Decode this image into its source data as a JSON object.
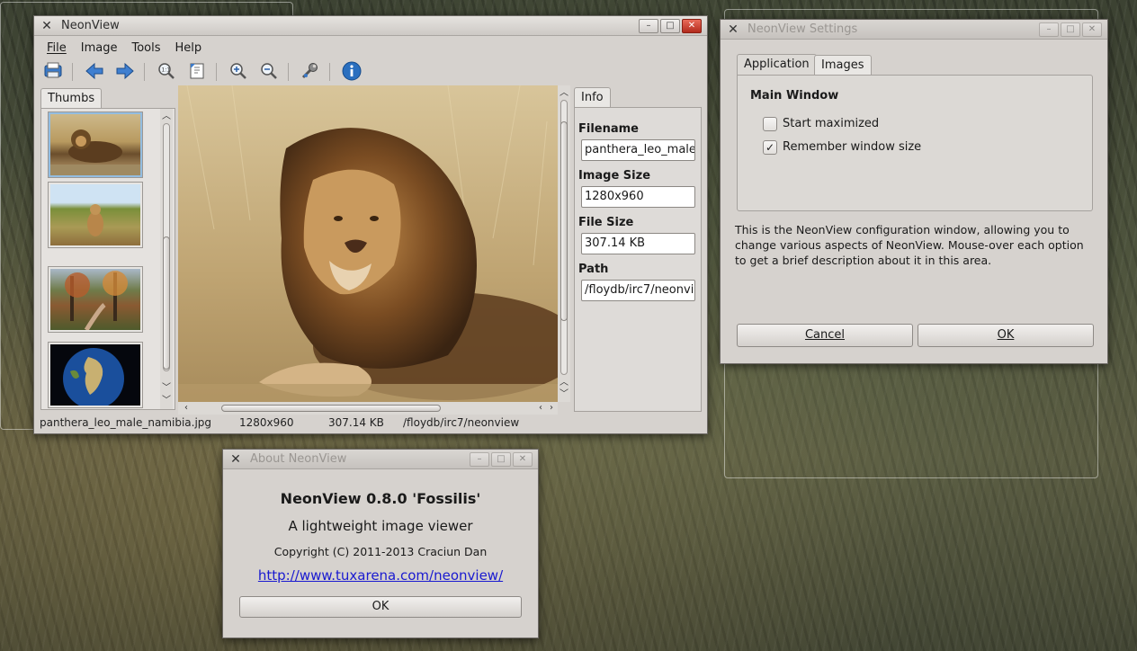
{
  "main_window": {
    "title": "NeonView",
    "menu": [
      "File",
      "Image",
      "Tools",
      "Help"
    ],
    "toolbar_icons": [
      "save-icon",
      "back-arrow-icon",
      "forward-arrow-icon",
      "zoom-original-icon",
      "fit-page-icon",
      "zoom-in-icon",
      "zoom-out-icon",
      "settings-wrench-icon",
      "info-icon"
    ],
    "thumbs_tab": "Thumbs",
    "info_tab": "Info",
    "info": {
      "filename_label": "Filename",
      "filename_value": "panthera_leo_male",
      "size_label": "Image Size",
      "size_value": "1280x960",
      "filesize_label": "File Size",
      "filesize_value": "307.14 KB",
      "path_label": "Path",
      "path_value": "/floydb/irc7/neonvie"
    },
    "status": {
      "filename": "panthera_leo_male_namibia.jpg",
      "dimensions": "1280x960",
      "filesize": "307.14 KB",
      "path": "/floydb/irc7/neonview"
    }
  },
  "settings_window": {
    "title": "NeonView Settings",
    "tabs": [
      "Application",
      "Images"
    ],
    "group_title": "Main Window",
    "option_start_maximized": "Start maximized",
    "option_remember_size": "Remember window size",
    "start_maximized_checked": false,
    "remember_size_checked": true,
    "description": "This is the NeonView configuration window, allowing you to change various aspects of NeonView. Mouse-over each option to get a brief description about it in this area.",
    "cancel_label": "Cancel",
    "ok_label": "OK"
  },
  "about_window": {
    "title": "About NeonView",
    "heading": "NeonView 0.8.0 'Fossilis'",
    "subtitle": "A lightweight image viewer",
    "copyright": "Copyright (C) 2011-2013 Craciun Dan",
    "link": "http://www.tuxarena.com/neonview/",
    "ok_label": "OK"
  },
  "window_buttons": {
    "minimize": "–",
    "maximize": "□",
    "close": "✕"
  },
  "colors": {
    "accent_blue": "#2a6fbf",
    "link": "#1a1ad0",
    "selection": "#93bde0"
  }
}
